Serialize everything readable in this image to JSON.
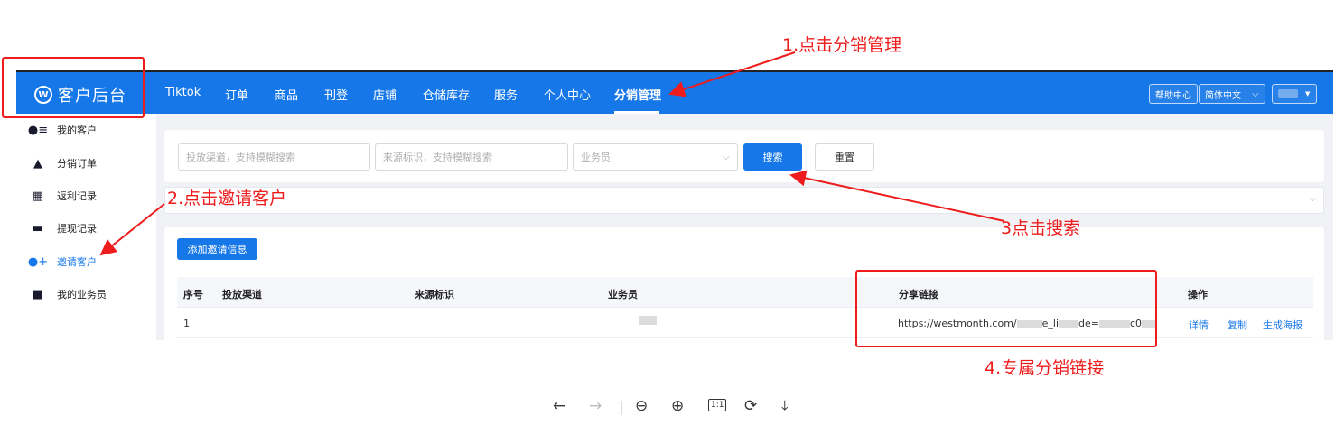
{
  "header": {
    "logo_text": "客户后台",
    "logo_mark": "W",
    "nav": [
      "Tiktok",
      "订单",
      "商品",
      "刊登",
      "店铺",
      "仓储库存",
      "服务",
      "个人中心",
      "分销管理"
    ],
    "active_nav": "分销管理",
    "help_label": "帮助中心",
    "language_label": "简体中文"
  },
  "sidebar": {
    "items": [
      "我的客户",
      "分销订单",
      "返利记录",
      "提现记录",
      "邀请客户",
      "我的业务员"
    ],
    "active": "邀请客户"
  },
  "filters": {
    "channel_placeholder": "投放渠道，支持模糊搜索",
    "source_placeholder": "来源标识，支持模糊搜索",
    "salesperson_placeholder": "业务员",
    "search_label": "搜索",
    "reset_label": "重置"
  },
  "actions": {
    "add_label": "添加邀请信息"
  },
  "table": {
    "headers": [
      "序号",
      "投放渠道",
      "来源标识",
      "业务员",
      "分享链接",
      "操作"
    ],
    "rows": [
      {
        "index": "1",
        "channel": "",
        "source": "",
        "salesperson": "",
        "share_link": "https://westmonth.com/",
        "link_tail_1": "e_li",
        "link_tail_2": "de=",
        "link_tail_3": "c0",
        "ops": [
          "详情",
          "复制",
          "生成海报"
        ]
      }
    ]
  },
  "annotations": {
    "step1": "1.点击分销管理",
    "step2": "2.点击邀请客户",
    "step3": "3点击搜索",
    "step4": "4.专属分销链接"
  },
  "colors": {
    "brand_blue": "#1677e8",
    "annotation_red": "#ee1c1c"
  },
  "viewer_toolbar": [
    "arrow-left-icon",
    "arrow-right-icon",
    "zoom-out-icon",
    "zoom-in-icon",
    "actual-size-icon",
    "rotate-icon",
    "download-icon"
  ],
  "viewer_actual_size_label": "1:1"
}
